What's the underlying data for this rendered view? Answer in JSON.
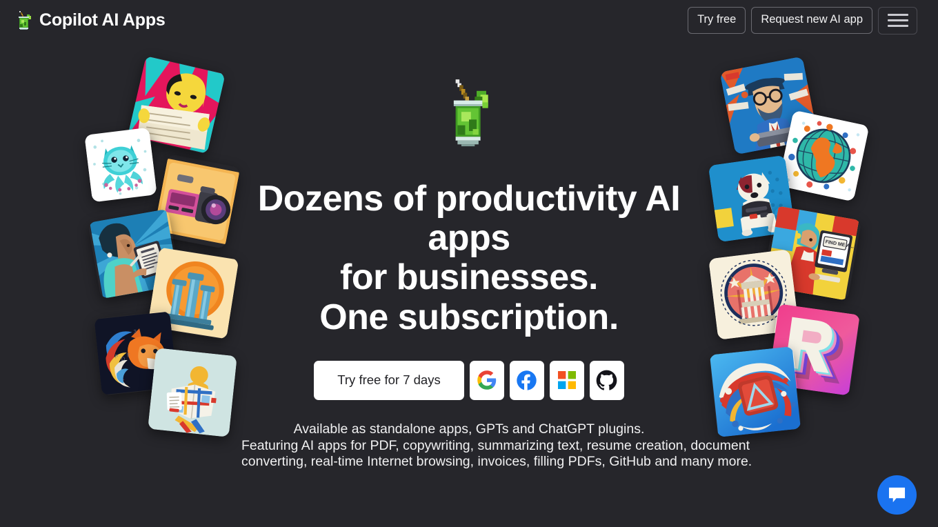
{
  "page": {
    "background_color": "#26262b",
    "text_color": "#ffffff"
  },
  "header": {
    "brand_emoji_name": "tropical-drink-emoji",
    "brand_title": "Copilot AI Apps",
    "try_free_label": "Try free",
    "request_app_label": "Request new AI app",
    "menu_label": "Toggle navigation"
  },
  "hero": {
    "badge_emoji_name": "tropical-drink-emoji",
    "title_line_1": "Dozens of productivity AI apps",
    "title_line_2": "for businesses.",
    "title_line_3": "One subscription.",
    "cta_primary_label": "Try free for 7 days",
    "social_buttons": [
      {
        "name": "google-signin-button",
        "icon": "google-icon",
        "label": "Sign in with Google"
      },
      {
        "name": "facebook-signin-button",
        "icon": "facebook-icon",
        "label": "Sign in with Facebook"
      },
      {
        "name": "microsoft-signin-button",
        "icon": "microsoft-icon",
        "label": "Sign in with Microsoft"
      },
      {
        "name": "github-signin-button",
        "icon": "github-icon",
        "label": "Sign in with GitHub"
      }
    ],
    "subtitle_line_1": "Available as standalone apps, GPTs and ChatGPT plugins.",
    "subtitle_line_2": "Featuring AI apps for PDF, copywriting, summarizing text, resume creation, document",
    "subtitle_line_3": "converting, real-time Internet browsing, invoices, filling PDFs, GitHub and many more."
  },
  "decor": {
    "left_cards": [
      {
        "name": "app-card-woman-newspaper",
        "alt": "Pop-art woman reading a newspaper"
      },
      {
        "name": "app-card-octopus-cat",
        "alt": "Teal octopus-cat illustration on white"
      },
      {
        "name": "app-card-video-camera",
        "alt": "Retro video camera on orange"
      },
      {
        "name": "app-card-woman-tablet",
        "alt": "Woman writing on a tablet, blue rays"
      },
      {
        "name": "app-card-greek-columns",
        "alt": "Greek columns on orange sun"
      },
      {
        "name": "app-card-fox-swirl",
        "alt": "Colorful fox with swirling mane on dark"
      },
      {
        "name": "app-card-map-reader",
        "alt": "Person reading a folded map"
      }
    ],
    "right_cards": [
      {
        "name": "app-card-bearded-typist",
        "alt": "Bearded man in glasses typing on typewriter"
      },
      {
        "name": "app-card-globe-network",
        "alt": "Globe surrounded by colorful dots"
      },
      {
        "name": "app-card-dog-vest",
        "alt": "Jack Russell dog in a tactical vest on blue"
      },
      {
        "name": "app-card-find-me-screen",
        "alt": "Woman at computer with FIND ME A... screen"
      },
      {
        "name": "app-card-capitol-badge",
        "alt": "Government building badge with stars"
      },
      {
        "name": "app-card-letter-r",
        "alt": "3D retro letter R on pink gradient"
      },
      {
        "name": "app-card-letter-a",
        "alt": "3D red letter A with swirls on blue"
      }
    ]
  },
  "chat": {
    "fab_name": "chat-bubble-icon",
    "fab_label": "Open chat",
    "accent_color": "#1a73f0"
  }
}
